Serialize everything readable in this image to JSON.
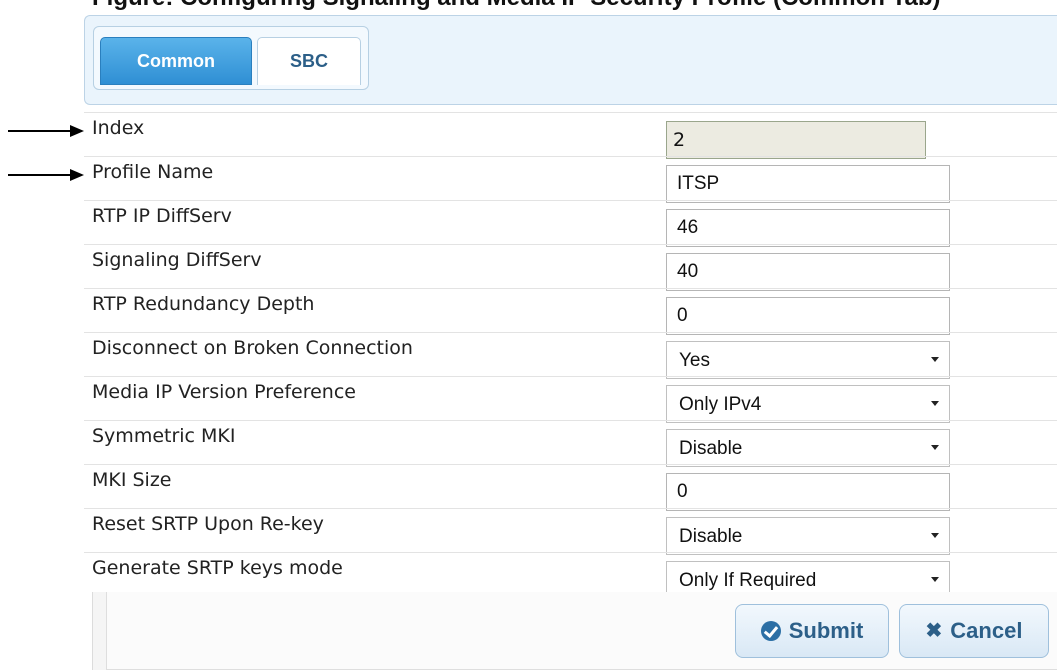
{
  "caption": "Figure: Configuring Signaling and Media IP Security Profile (Common Tab)",
  "tabs": [
    {
      "label": "Common",
      "active": true
    },
    {
      "label": "SBC",
      "active": false
    }
  ],
  "fields": [
    {
      "label": "Index",
      "value": "2"
    },
    {
      "label": "Profile Name",
      "value": "ITSP"
    },
    {
      "label": "RTP IP DiffServ",
      "value": "46"
    },
    {
      "label": "Signaling DiffServ",
      "value": "40"
    },
    {
      "label": "RTP Redundancy Depth",
      "value": "0"
    },
    {
      "label": "Disconnect on Broken Connection",
      "value": "Yes"
    },
    {
      "label": "Media IP Version Preference",
      "value": "Only IPv4"
    },
    {
      "label": "Symmetric MKI",
      "value": "Disable"
    },
    {
      "label": "MKI Size",
      "value": "0"
    },
    {
      "label": "Reset SRTP Upon Re-key",
      "value": "Disable"
    },
    {
      "label": "Generate SRTP keys mode",
      "value": "Only If Required"
    }
  ],
  "buttons": {
    "submit_label": "Submit",
    "cancel_label": "Cancel"
  },
  "icons": {
    "submit": "check-circle-icon",
    "cancel": "x-icon",
    "dropdown": "chevron-down-icon",
    "pointer": "arrow-right-icon"
  },
  "colors": {
    "tab_active": "#3b9ee0",
    "tab_text": "#2c5f88",
    "readonly_bg": "#ecebe1"
  }
}
